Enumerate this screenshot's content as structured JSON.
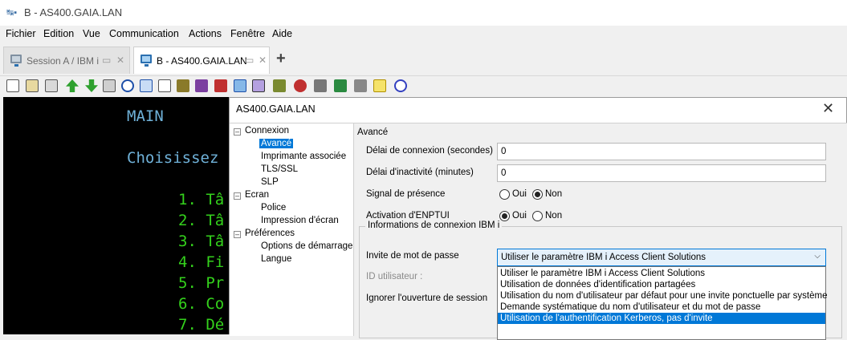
{
  "window": {
    "title": "B - AS400.GAIA.LAN",
    "icon": "app-icon"
  },
  "menu": [
    "Fichier",
    "Edition",
    "Vue",
    "Communication",
    "Actions",
    "Fenêtre",
    "Aide"
  ],
  "tabs": [
    {
      "label": "Session A / IBM i",
      "active": false
    },
    {
      "label": "B - AS400.GAIA.LAN",
      "active": true
    }
  ],
  "toolbar_icons": [
    "copy-icon",
    "paste-icon",
    "clipboard-icon",
    "upload-icon",
    "download-icon",
    "print-icon",
    "compass-icon",
    "window-icon",
    "document-icon",
    "gear-puzzle-icon",
    "macro-icon",
    "keyboard-icon",
    "display-icon",
    "grid-icon",
    "tools-icon",
    "record-icon",
    "stop-icon",
    "play-icon",
    "step-icon",
    "notes-icon",
    "help-icon"
  ],
  "terminal": {
    "title": "MAIN",
    "prompt": "Choisissez",
    "items": [
      "1. Tâ",
      "2. Tâ",
      "3. Tâ",
      "4. Fi",
      "5. Pr",
      "6. Co",
      "7. Dé"
    ]
  },
  "dialog": {
    "title": "AS400.GAIA.LAN",
    "tree": {
      "connexion": "Connexion",
      "avance": "Avancé",
      "imprimante": "Imprimante associée",
      "tls": "TLS/SSL",
      "slp": "SLP",
      "ecran": "Ecran",
      "police": "Police",
      "impression": "Impression d'écran",
      "preferences": "Préférences",
      "options": "Options de démarrage",
      "langue": "Langue"
    },
    "panel": {
      "section_title": "Avancé",
      "delai_connexion_label": "Délai de connexion (secondes)",
      "delai_connexion_value": "0",
      "delai_inactivite_label": "Délai d'inactivité (minutes)",
      "delai_inactivite_value": "0",
      "signal_label": "Signal de présence",
      "signal_oui": "Oui",
      "signal_non": "Non",
      "signal_selected": "Non",
      "enptui_label": "Activation d'ENPTUI",
      "enptui_oui": "Oui",
      "enptui_non": "Non",
      "enptui_selected": "Oui",
      "group_title": "Informations de connexion IBM i",
      "invite_label": "Invite de mot de passe",
      "invite_value": "Utiliser le paramètre IBM i Access Client Solutions",
      "id_label": "ID utilisateur :",
      "ignorer_label": "Ignorer l'ouverture de session",
      "options": [
        "Utiliser le paramètre IBM i Access Client Solutions",
        "Utilisation de données d'identification partagées",
        "Utilisation du nom d'utilisateur par défaut pour une invite ponctuelle par système",
        "Demande systématique du nom d'utilisateur et du mot de passe",
        "Utilisation de l'authentification Kerberos, pas d'invite"
      ],
      "highlighted_option": 4
    }
  }
}
